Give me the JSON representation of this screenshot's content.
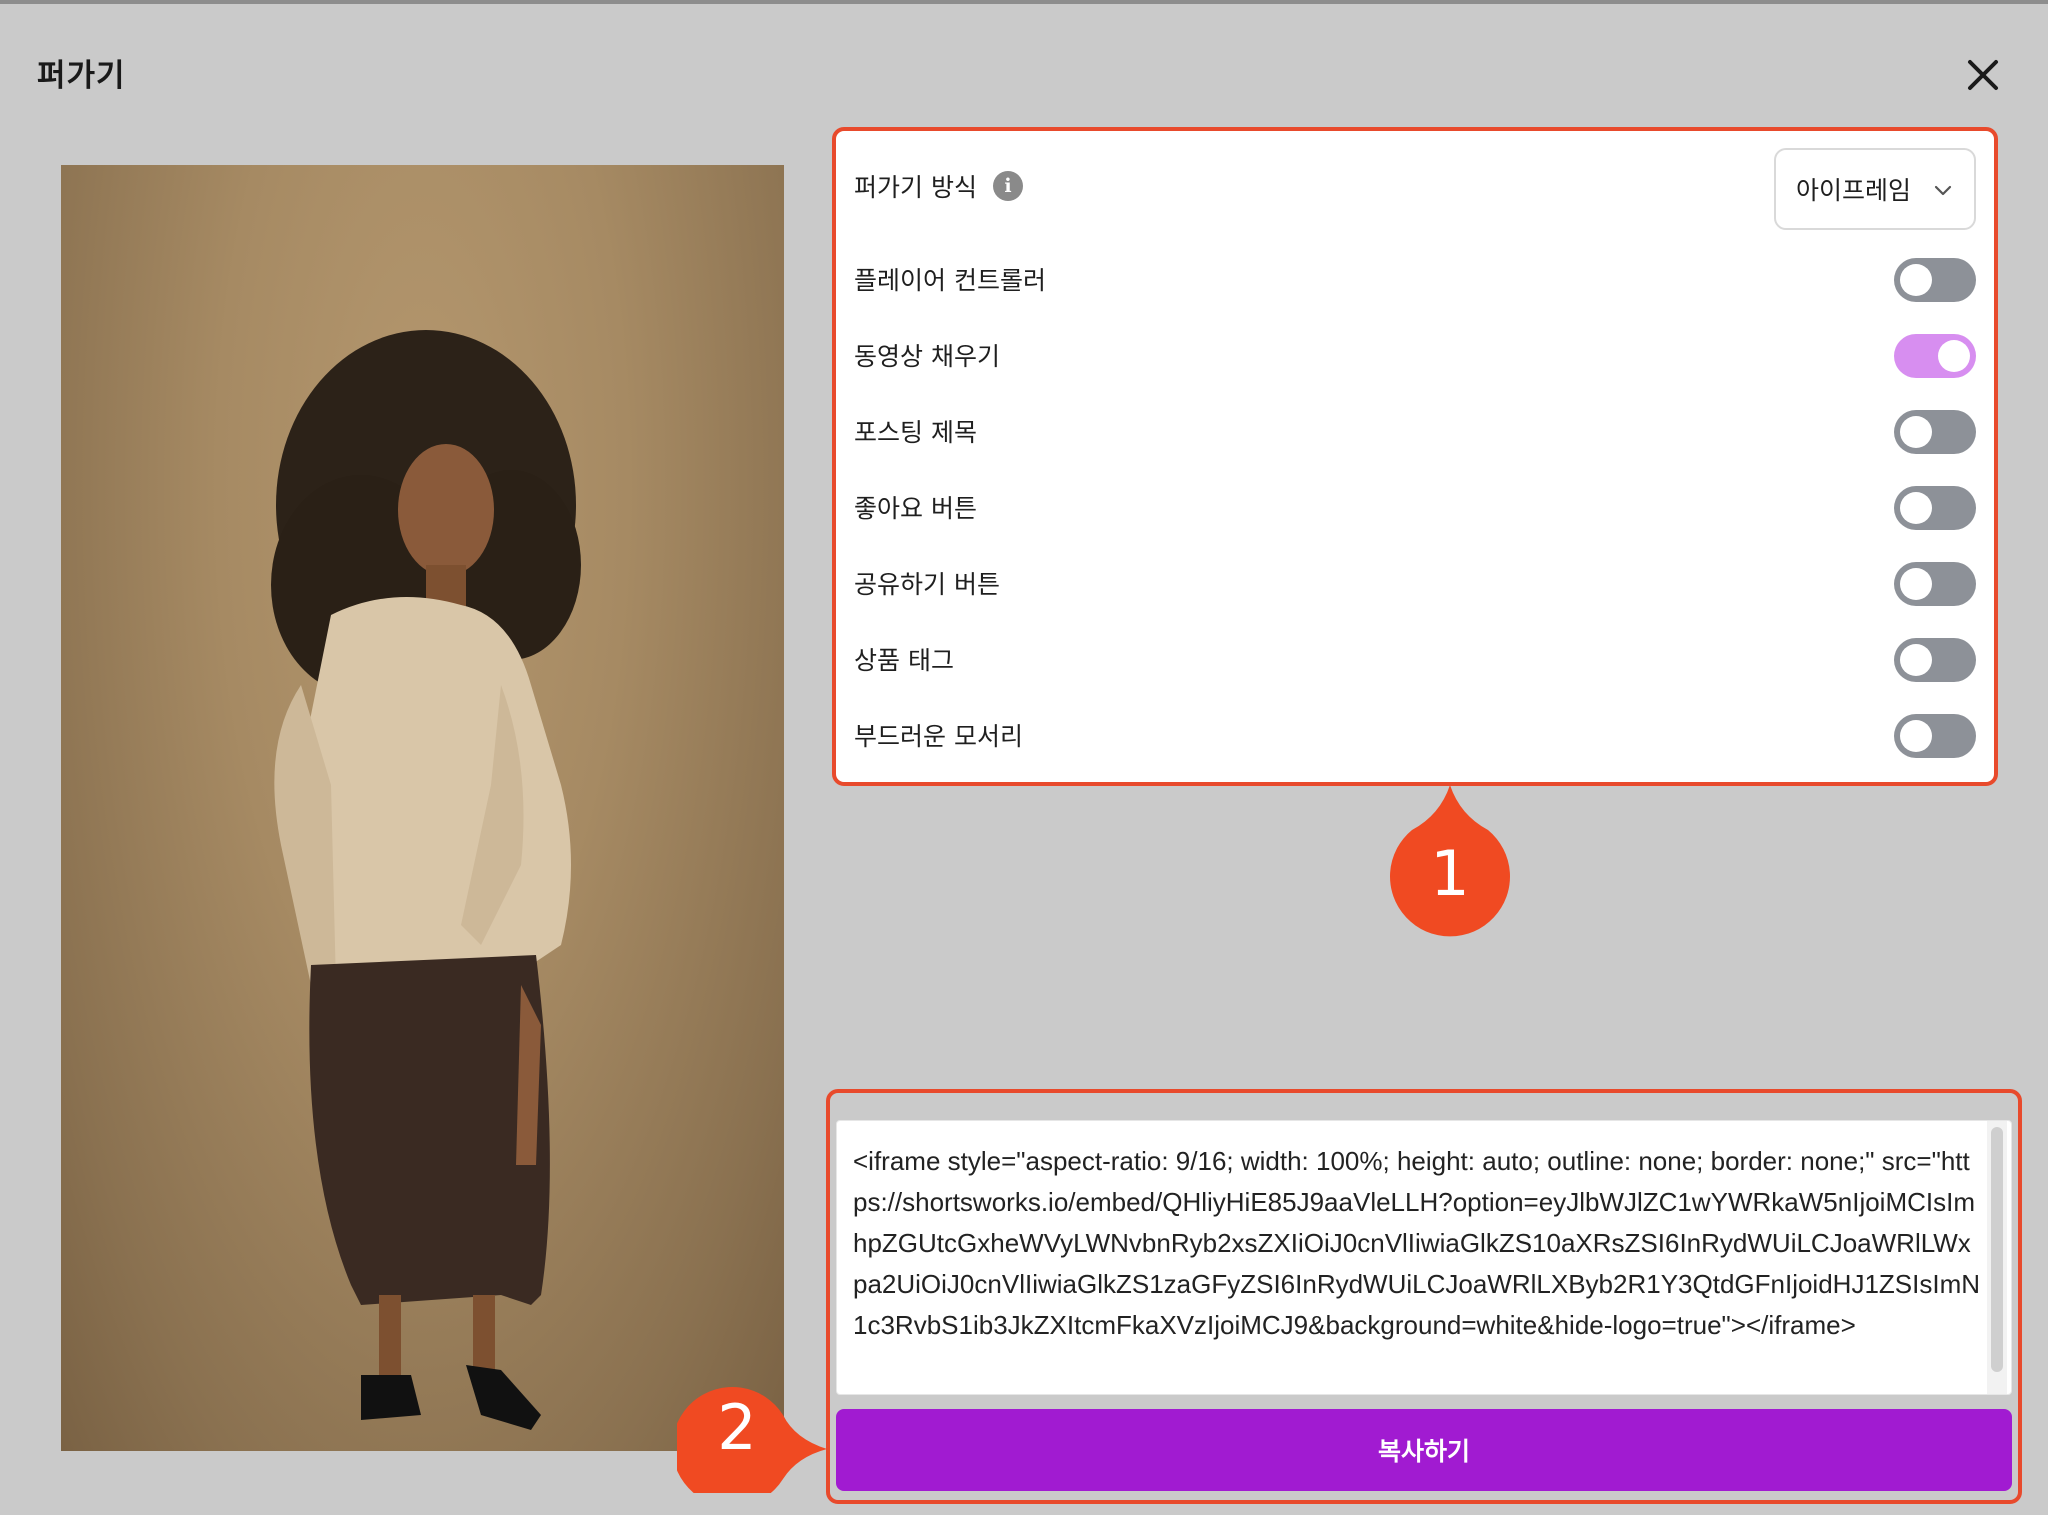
{
  "dialog": {
    "title": "퍼가기"
  },
  "settings": {
    "method_label": "퍼가기 방식",
    "method_value": "아이프레임",
    "toggles": [
      {
        "label": "플레이어 컨트롤러",
        "on": false
      },
      {
        "label": "동영상 채우기",
        "on": true
      },
      {
        "label": "포스팅 제목",
        "on": false
      },
      {
        "label": "좋아요 버튼",
        "on": false
      },
      {
        "label": "공유하기 버튼",
        "on": false
      },
      {
        "label": "상품 태그",
        "on": false
      },
      {
        "label": "부드러운 모서리",
        "on": false
      }
    ]
  },
  "embed": {
    "code": "<iframe style=\"aspect-ratio: 9/16; width: 100%; height: auto; outline: none; border: none;\" src=\"https://shortsworks.io/embed/QHliyHiE85J9aaVleLLH?option=eyJlbWJlZC1wYWRkaW5nIjoiMCIsImhpZGUtcGxheWVyLWNvbnRyb2xsZXIiOiJ0cnVlIiwiaGlkZS10aXRsZSI6InRydWUiLCJoaWRlLWxpa2UiOiJ0cnVlIiwiaGlkZS1zaGFyZSI6InRydWUiLCJoaWRlLXByb2R1Y3QtdGFnIjoidHJ1ZSIsImN1c3RvbS1ib3JkZXItcmFkaXVzIjoiMCJ9&background=white&hide-logo=true\"></iframe>",
    "copy_label": "복사하기"
  },
  "callouts": [
    "1",
    "2"
  ],
  "colors": {
    "accent_red": "#e84a2c",
    "copy_purple": "#a11bd1",
    "toggle_on": "#d78ef0",
    "toggle_off": "#8d9198"
  }
}
